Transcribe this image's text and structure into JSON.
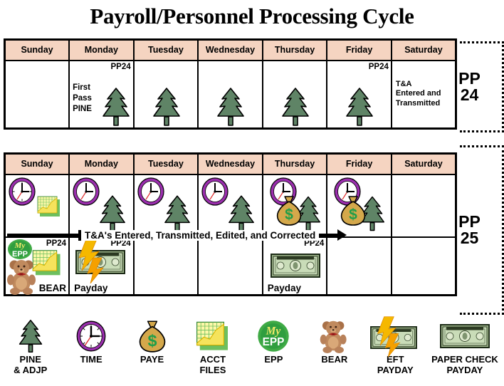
{
  "title": "Payroll/Personnel Processing Cycle",
  "colors": {
    "header_bg": "#f5d4c1",
    "tree_green": "#5f8466",
    "clock_ring": "#9b2fae",
    "bag_tan": "#d4a84b",
    "dollar_green": "#1f9e4a",
    "epp_green": "#2f9e3f",
    "bear_brown": "#b07b52",
    "bill_green": "#cfe0c0",
    "bolt_yellow": "#f5b800",
    "border": "#000000"
  },
  "day_headers": [
    "Sunday",
    "Monday",
    "Tuesday",
    "Wednesday",
    "Thursday",
    "Friday",
    "Saturday"
  ],
  "pp24": {
    "bracket_label_line1": "PP",
    "bracket_label_line2": "24",
    "cells": [
      {
        "day": "Sunday",
        "tag": "",
        "note": "",
        "icons": []
      },
      {
        "day": "Monday",
        "tag": "PP24",
        "note": "First\nPass\nPINE",
        "icons": [
          "pine-tree"
        ]
      },
      {
        "day": "Tuesday",
        "tag": "",
        "note": "",
        "icons": [
          "pine-tree"
        ]
      },
      {
        "day": "Wednesday",
        "tag": "",
        "note": "",
        "icons": [
          "pine-tree"
        ]
      },
      {
        "day": "Thursday",
        "tag": "",
        "note": "",
        "icons": [
          "pine-tree"
        ]
      },
      {
        "day": "Friday",
        "tag": "PP24",
        "note": "",
        "icons": [
          "pine-tree"
        ]
      },
      {
        "day": "Saturday",
        "tag": "",
        "note": "T&A\nEntered and\nTransmitted",
        "icons": []
      }
    ]
  },
  "pp25": {
    "bracket_label_line1": "PP",
    "bracket_label_line2": "25",
    "band_text": "T&A's Entered, Transmitted, Edited, and Corrected",
    "row1": [
      {
        "day": "Sunday",
        "icons": [
          "clock",
          "acct-files"
        ]
      },
      {
        "day": "Monday",
        "icons": [
          "clock",
          "pine-tree"
        ]
      },
      {
        "day": "Tuesday",
        "icons": [
          "clock",
          "pine-tree"
        ]
      },
      {
        "day": "Wednesday",
        "icons": [
          "clock",
          "pine-tree"
        ]
      },
      {
        "day": "Thursday",
        "icons": [
          "clock",
          "money-bag",
          "pine-tree"
        ]
      },
      {
        "day": "Friday",
        "icons": [
          "clock",
          "money-bag",
          "pine-tree"
        ]
      },
      {
        "day": "Saturday",
        "icons": []
      }
    ],
    "row2": [
      {
        "day": "Sunday",
        "tag": "PP24",
        "label": "BEAR",
        "icons": [
          "epp-badge",
          "acct-files",
          "bear"
        ]
      },
      {
        "day": "Monday",
        "tag": "PP24",
        "label": "Payday",
        "icons": [
          "lightning-bolt",
          "dollar-bill"
        ]
      },
      {
        "day": "Tuesday",
        "tag": "",
        "label": "",
        "icons": []
      },
      {
        "day": "Wednesday",
        "tag": "",
        "label": "",
        "icons": []
      },
      {
        "day": "Thursday",
        "tag": "PP24",
        "label": "Payday",
        "icons": [
          "dollar-bill"
        ]
      },
      {
        "day": "Friday",
        "tag": "",
        "label": "",
        "icons": []
      },
      {
        "day": "Saturday",
        "tag": "",
        "label": "",
        "icons": []
      }
    ]
  },
  "legend": [
    {
      "icon": "pine-tree",
      "label": "PINE\n& ADJP"
    },
    {
      "icon": "clock",
      "label": "TIME"
    },
    {
      "icon": "money-bag",
      "label": "PAYE"
    },
    {
      "icon": "acct-files",
      "label": "ACCT\nFILES"
    },
    {
      "icon": "epp-badge",
      "label": "EPP"
    },
    {
      "icon": "bear",
      "label": "BEAR"
    },
    {
      "icon": "eft-payday",
      "label": "EFT\nPAYDAY"
    },
    {
      "icon": "paper-check",
      "label": "PAPER CHECK\nPAYDAY"
    }
  ]
}
